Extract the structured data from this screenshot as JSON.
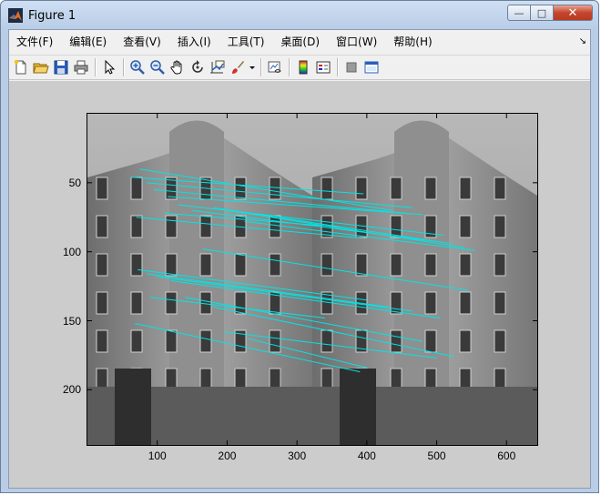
{
  "window": {
    "title": "Figure 1",
    "min_glyph": "—",
    "max_glyph": "□",
    "close_glyph": "✕"
  },
  "menu": {
    "items": [
      "文件(F)",
      "编辑(E)",
      "查看(V)",
      "插入(I)",
      "工具(T)",
      "桌面(D)",
      "窗口(W)",
      "帮助(H)"
    ],
    "overflow_glyph": "↘"
  },
  "toolbar": {
    "buttons": [
      "new-figure-icon",
      "open-file-icon",
      "save-icon",
      "print-icon",
      "pointer-icon",
      "zoom-in-icon",
      "zoom-out-icon",
      "pan-hand-icon",
      "rotate-3d-icon",
      "data-cursor-icon",
      "brush-icon",
      "brush-dropdown-icon",
      "link-plot-icon",
      "colorbar-icon",
      "legend-icon",
      "hide-plot-tools-icon",
      "show-plot-tools-icon"
    ]
  },
  "chart_data": {
    "type": "scatter",
    "title": "",
    "xlabel": "",
    "ylabel": "",
    "xlim": [
      0,
      644
    ],
    "ylim": [
      240,
      0
    ],
    "y_reversed": true,
    "xticks": [
      "100",
      "200",
      "300",
      "400",
      "500",
      "600"
    ],
    "yticks": [
      "50",
      "100",
      "150",
      "200"
    ],
    "xtick_values": [
      100,
      200,
      300,
      400,
      500,
      600
    ],
    "ytick_values": [
      50,
      100,
      150,
      200
    ],
    "background_image": "grayscale side-by-side photos of the same corner building",
    "match_line_color": "#00e5e5",
    "match_lines": [
      {
        "x1": 62,
        "y1": 46,
        "x2": 395,
        "y2": 58
      },
      {
        "x1": 75,
        "y1": 40,
        "x2": 435,
        "y2": 70
      },
      {
        "x1": 85,
        "y1": 50,
        "x2": 465,
        "y2": 68
      },
      {
        "x1": 95,
        "y1": 55,
        "x2": 455,
        "y2": 72
      },
      {
        "x1": 115,
        "y1": 60,
        "x2": 480,
        "y2": 73
      },
      {
        "x1": 130,
        "y1": 66,
        "x2": 510,
        "y2": 88
      },
      {
        "x1": 150,
        "y1": 70,
        "x2": 490,
        "y2": 92
      },
      {
        "x1": 180,
        "y1": 68,
        "x2": 520,
        "y2": 94
      },
      {
        "x1": 70,
        "y1": 75,
        "x2": 390,
        "y2": 90
      },
      {
        "x1": 110,
        "y1": 72,
        "x2": 360,
        "y2": 82
      },
      {
        "x1": 200,
        "y1": 70,
        "x2": 540,
        "y2": 97
      },
      {
        "x1": 225,
        "y1": 78,
        "x2": 555,
        "y2": 99
      },
      {
        "x1": 165,
        "y1": 98,
        "x2": 545,
        "y2": 128
      },
      {
        "x1": 72,
        "y1": 113,
        "x2": 400,
        "y2": 135
      },
      {
        "x1": 85,
        "y1": 116,
        "x2": 430,
        "y2": 140
      },
      {
        "x1": 100,
        "y1": 118,
        "x2": 465,
        "y2": 143
      },
      {
        "x1": 120,
        "y1": 121,
        "x2": 505,
        "y2": 148
      },
      {
        "x1": 90,
        "y1": 133,
        "x2": 340,
        "y2": 148
      },
      {
        "x1": 140,
        "y1": 133,
        "x2": 480,
        "y2": 165
      },
      {
        "x1": 180,
        "y1": 140,
        "x2": 525,
        "y2": 176
      },
      {
        "x1": 68,
        "y1": 152,
        "x2": 390,
        "y2": 187
      },
      {
        "x1": 195,
        "y1": 158,
        "x2": 500,
        "y2": 177
      },
      {
        "x1": 230,
        "y1": 163,
        "x2": 400,
        "y2": 184
      }
    ]
  }
}
